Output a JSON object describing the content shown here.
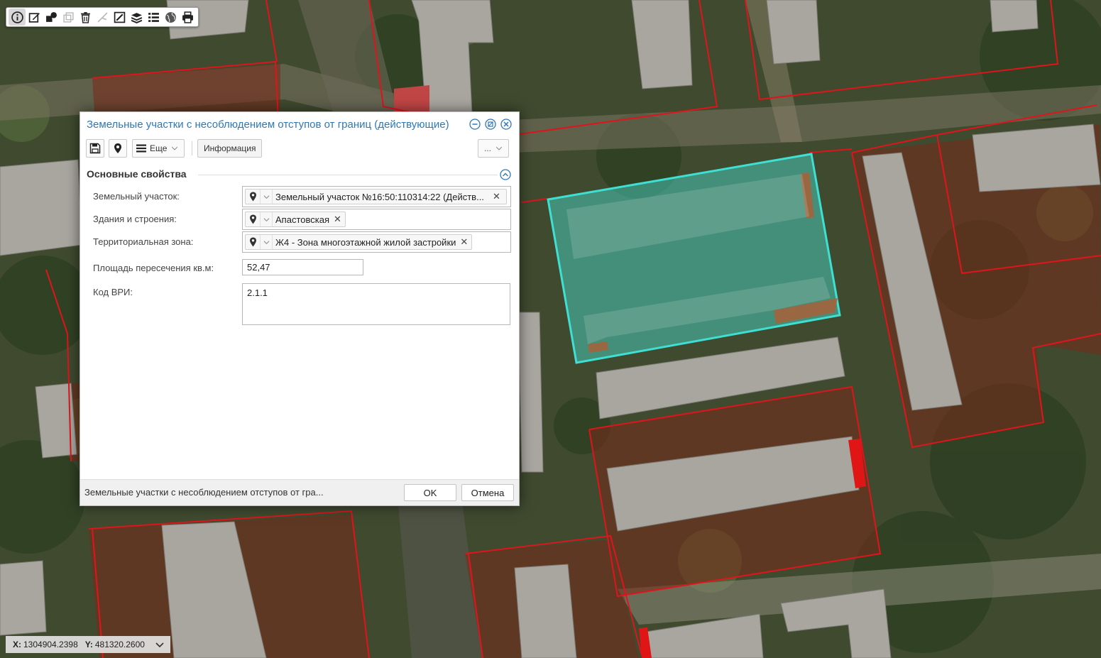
{
  "toolbar": {
    "tools": [
      "info-icon",
      "edit-icon",
      "select-objects-icon",
      "copy-icon",
      "delete-icon",
      "measure-icon",
      "draw-icon",
      "layers-icon",
      "list-icon",
      "globe-icon",
      "print-icon"
    ]
  },
  "coords": {
    "x_label": "X:",
    "x_value": "1304904.2398",
    "y_label": "Y:",
    "y_value": "481320.2600"
  },
  "dialog": {
    "title": "Земельные участки с несоблюдением отступов от границ (действующие)",
    "toolbar": {
      "more_label": "Еще",
      "info_label": "Информация",
      "dots_label": "..."
    },
    "section_title": "Основные свойства",
    "fields": {
      "land_plot": {
        "label": "Земельный участок:",
        "value": "Земельный участок №16:50:110314:22 (Действ..."
      },
      "buildings": {
        "label": "Здания и строения:",
        "value": "Апастовская"
      },
      "zone": {
        "label": "Территориальная зона:",
        "value": "Ж4 - Зона многоэтажной жилой застройки"
      },
      "area": {
        "label": "Площадь пересечения кв.м:",
        "value": "52,47"
      },
      "vri": {
        "label": "Код ВРИ:",
        "value": "2.1.1"
      }
    },
    "footer": {
      "status": "Земельные участки с несоблюдением отступов от гра...",
      "ok_label": "OK",
      "cancel_label": "Отмена"
    }
  },
  "colors": {
    "accent": "#2f78b7",
    "highlight": "#3de0d3",
    "parcel_border": "#e0141b"
  }
}
